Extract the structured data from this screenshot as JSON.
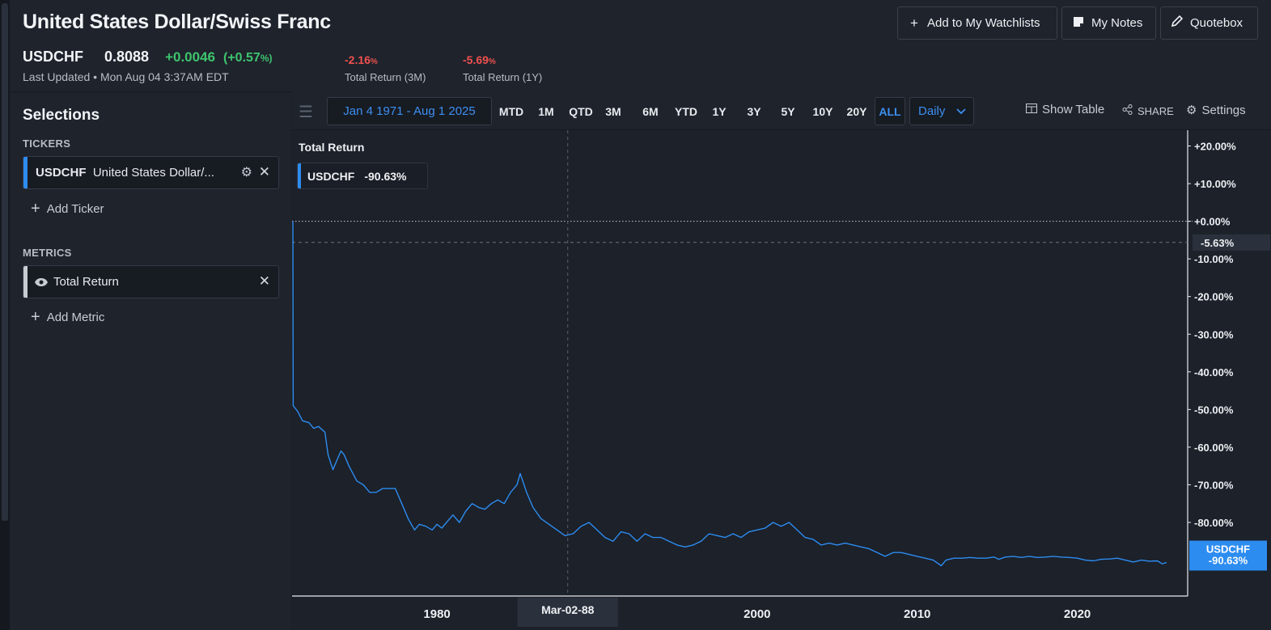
{
  "header": {
    "title": "United States Dollar/Swiss Franc",
    "symbol": "USDCHF",
    "price": "0.8088",
    "change": "+0.0046",
    "change_pct": "(+0.57",
    "change_pct_unit": "%)",
    "last_updated": "Last Updated • Mon Aug 04 3:37AM EDT",
    "returns": [
      {
        "value": "-2.16",
        "unit": "%",
        "label": "Total Return (3M)"
      },
      {
        "value": "-5.69",
        "unit": "%",
        "label": "Total Return (1Y)"
      }
    ],
    "buttons": {
      "watchlist": "Add to My Watchlists",
      "notes": "My Notes",
      "quotebox": "Quotebox"
    }
  },
  "sidebar": {
    "title": "Selections",
    "tickers_label": "TICKERS",
    "ticker": {
      "symbol": "USDCHF",
      "name": "United States Dollar/...",
      "color": "#2d8cf0"
    },
    "add_ticker": "Add Ticker",
    "metrics_label": "METRICS",
    "metric": {
      "name": "Total Return",
      "color": "#c7cbd2"
    },
    "add_metric": "Add Metric"
  },
  "toolbar": {
    "date_range": "Jan 4 1971 - Aug 1 2025",
    "ranges": [
      "MTD",
      "1M",
      "QTD",
      "3M",
      "6M",
      "YTD",
      "1Y",
      "3Y",
      "5Y",
      "10Y",
      "20Y",
      "ALL"
    ],
    "active_range": "ALL",
    "frequency": "Daily",
    "show_table": "Show Table",
    "share": "SHARE",
    "settings": "Settings"
  },
  "chart_data": {
    "type": "line",
    "title": "Total Return",
    "series": [
      {
        "name": "USDCHF",
        "color": "#2d8cf0",
        "last_value_label": "-90.63%",
        "points": [
          [
            1971.0,
            0
          ],
          [
            1971.02,
            -49
          ],
          [
            1971.3,
            -50.5
          ],
          [
            1971.6,
            -53
          ],
          [
            1972.0,
            -53.5
          ],
          [
            1972.3,
            -55
          ],
          [
            1972.6,
            -54.5
          ],
          [
            1973.0,
            -56
          ],
          [
            1973.2,
            -62
          ],
          [
            1973.5,
            -66
          ],
          [
            1973.7,
            -64
          ],
          [
            1974.0,
            -61
          ],
          [
            1974.2,
            -62
          ],
          [
            1974.5,
            -65
          ],
          [
            1975.0,
            -69
          ],
          [
            1975.4,
            -70
          ],
          [
            1975.8,
            -72
          ],
          [
            1976.2,
            -72
          ],
          [
            1976.6,
            -71
          ],
          [
            1977.0,
            -71
          ],
          [
            1977.4,
            -71
          ],
          [
            1977.8,
            -75
          ],
          [
            1978.2,
            -79
          ],
          [
            1978.6,
            -82
          ],
          [
            1978.9,
            -80.5
          ],
          [
            1979.3,
            -81
          ],
          [
            1979.7,
            -82
          ],
          [
            1980.0,
            -80.5
          ],
          [
            1980.3,
            -81.5
          ],
          [
            1980.7,
            -79.5
          ],
          [
            1981.0,
            -78
          ],
          [
            1981.4,
            -80
          ],
          [
            1981.8,
            -77
          ],
          [
            1982.2,
            -75
          ],
          [
            1982.6,
            -76
          ],
          [
            1983.0,
            -76.5
          ],
          [
            1983.4,
            -75
          ],
          [
            1983.8,
            -74
          ],
          [
            1984.2,
            -75
          ],
          [
            1984.6,
            -72
          ],
          [
            1985.0,
            -70
          ],
          [
            1985.2,
            -67
          ],
          [
            1985.6,
            -72
          ],
          [
            1986.0,
            -76
          ],
          [
            1986.5,
            -79
          ],
          [
            1987.0,
            -80.5
          ],
          [
            1987.5,
            -82
          ],
          [
            1988.0,
            -83.5
          ],
          [
            1988.5,
            -83
          ],
          [
            1989.0,
            -81
          ],
          [
            1989.5,
            -80
          ],
          [
            1990.0,
            -82
          ],
          [
            1990.5,
            -84
          ],
          [
            1991.0,
            -85
          ],
          [
            1991.5,
            -82.5
          ],
          [
            1992.0,
            -83
          ],
          [
            1992.5,
            -85
          ],
          [
            1993.0,
            -83
          ],
          [
            1993.5,
            -84
          ],
          [
            1994.0,
            -84
          ],
          [
            1994.5,
            -85
          ],
          [
            1995.0,
            -86
          ],
          [
            1995.5,
            -86.5
          ],
          [
            1996.0,
            -86
          ],
          [
            1996.5,
            -85
          ],
          [
            1997.0,
            -83
          ],
          [
            1997.5,
            -83.5
          ],
          [
            1998.0,
            -84
          ],
          [
            1998.5,
            -83
          ],
          [
            1999.0,
            -84
          ],
          [
            1999.5,
            -82.5
          ],
          [
            2000.0,
            -82
          ],
          [
            2000.5,
            -81.5
          ],
          [
            2001.0,
            -80
          ],
          [
            2001.5,
            -81
          ],
          [
            2002.0,
            -80
          ],
          [
            2002.5,
            -82
          ],
          [
            2003.0,
            -84
          ],
          [
            2003.5,
            -84.5
          ],
          [
            2004.0,
            -86
          ],
          [
            2004.5,
            -85.5
          ],
          [
            2005.0,
            -86
          ],
          [
            2005.5,
            -85.5
          ],
          [
            2006.0,
            -86
          ],
          [
            2006.5,
            -86.5
          ],
          [
            2007.0,
            -87
          ],
          [
            2007.5,
            -88
          ],
          [
            2008.0,
            -89
          ],
          [
            2008.5,
            -88
          ],
          [
            2009.0,
            -88
          ],
          [
            2009.5,
            -88.5
          ],
          [
            2010.0,
            -89
          ],
          [
            2010.5,
            -89.5
          ],
          [
            2011.0,
            -90
          ],
          [
            2011.5,
            -91.5
          ],
          [
            2011.8,
            -90
          ],
          [
            2012.3,
            -89.5
          ],
          [
            2012.8,
            -89.5
          ],
          [
            2013.3,
            -89.3
          ],
          [
            2013.8,
            -89.5
          ],
          [
            2014.3,
            -89.5
          ],
          [
            2014.8,
            -89.2
          ],
          [
            2015.1,
            -89.8
          ],
          [
            2015.5,
            -89.2
          ],
          [
            2016.0,
            -89
          ],
          [
            2016.5,
            -89.3
          ],
          [
            2017.0,
            -89
          ],
          [
            2017.5,
            -89.3
          ],
          [
            2018.0,
            -89.2
          ],
          [
            2018.5,
            -89
          ],
          [
            2019.0,
            -89.2
          ],
          [
            2019.5,
            -89.3
          ],
          [
            2020.0,
            -89.5
          ],
          [
            2020.5,
            -90
          ],
          [
            2021.0,
            -90.2
          ],
          [
            2021.5,
            -89.8
          ],
          [
            2022.0,
            -89.7
          ],
          [
            2022.5,
            -89.5
          ],
          [
            2023.0,
            -90
          ],
          [
            2023.5,
            -90.5
          ],
          [
            2024.0,
            -90
          ],
          [
            2024.5,
            -90.3
          ],
          [
            2025.0,
            -90.2
          ],
          [
            2025.3,
            -91
          ],
          [
            2025.58,
            -90.63
          ]
        ]
      }
    ],
    "x_ticks": [
      "1980",
      "2000",
      "2010",
      "2020"
    ],
    "y_ticks": [
      "+20.00%",
      "+10.00%",
      "+0.00%",
      "-10.00%",
      "-20.00%",
      "-30.00%",
      "-40.00%",
      "-50.00%",
      "-60.00%",
      "-70.00%",
      "-80.00%"
    ],
    "ylim": [
      -100,
      25
    ],
    "xlim": [
      1971.0,
      2026.0
    ],
    "reference_line": {
      "value": -5.63,
      "label": "-5.63%"
    },
    "crosshair_label": "Mar-02-88",
    "last_label": {
      "name": "USDCHF",
      "value": "-90.63%"
    }
  }
}
